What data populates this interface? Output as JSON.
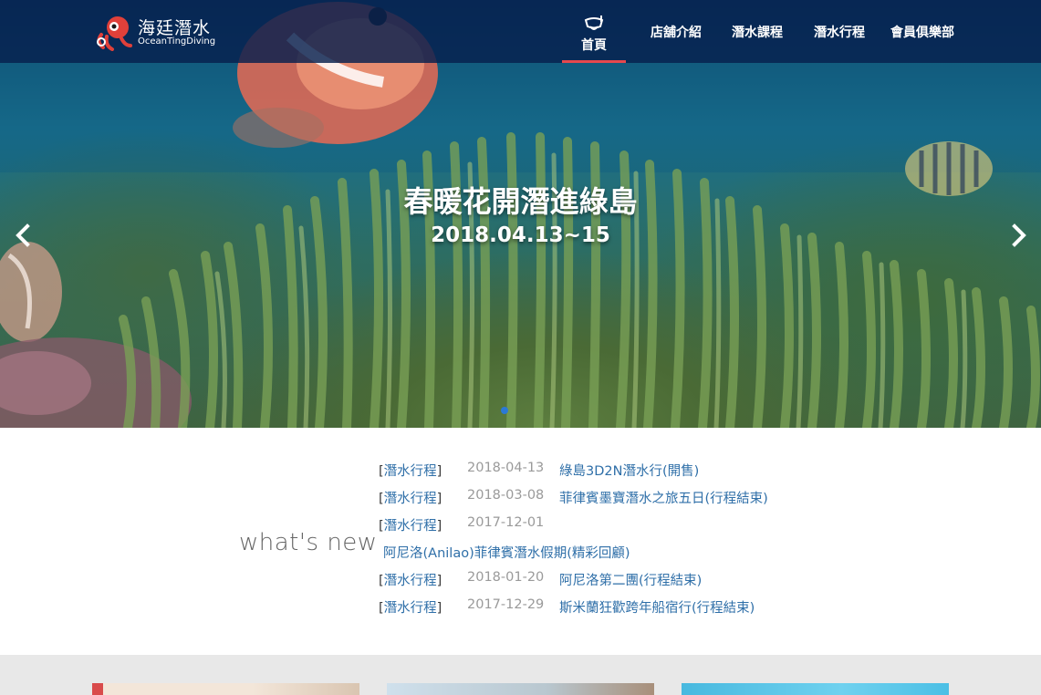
{
  "brand": {
    "name_cn": "海廷潛水",
    "name_en": "OceanTingDiving"
  },
  "nav": {
    "items": [
      {
        "label": "首頁",
        "active": true,
        "icon": "snorkel-mask-icon"
      },
      {
        "label": "店舖介紹"
      },
      {
        "label": "潛水課程"
      },
      {
        "label": "潛水行程"
      },
      {
        "label": "會員俱樂部"
      }
    ]
  },
  "slider": {
    "title": "春暖花開潛進綠島",
    "date": "2018.04.13~15",
    "prev_icon": "chevron-left-icon",
    "next_icon": "chevron-right-icon",
    "active_dot_color": "#2b79d6"
  },
  "news": {
    "heading": "what's new",
    "items": [
      {
        "category": "潛水行程",
        "date": "2018-04-13",
        "title": "綠島3D2N潛水行(開售)"
      },
      {
        "category": "潛水行程",
        "date": "2018-03-08",
        "title": "菲律賓墨寶潛水之旅五日(行程結束)"
      },
      {
        "category": "潛水行程",
        "date": "2017-12-01",
        "title": "阿尼洛(Anilao)菲律賓潛水假期(精彩回顧)"
      },
      {
        "category": "潛水行程",
        "date": "2018-01-20",
        "title": "阿尼洛第二團(行程結束)"
      },
      {
        "category": "潛水行程",
        "date": "2017-12-29",
        "title": "斯米蘭狂歡跨年船宿行(行程結束)"
      }
    ]
  },
  "colors": {
    "nav_bg": "#06204e",
    "active_underline": "#e5484d",
    "link": "#2f6fa8",
    "date": "#9a9a9a"
  }
}
